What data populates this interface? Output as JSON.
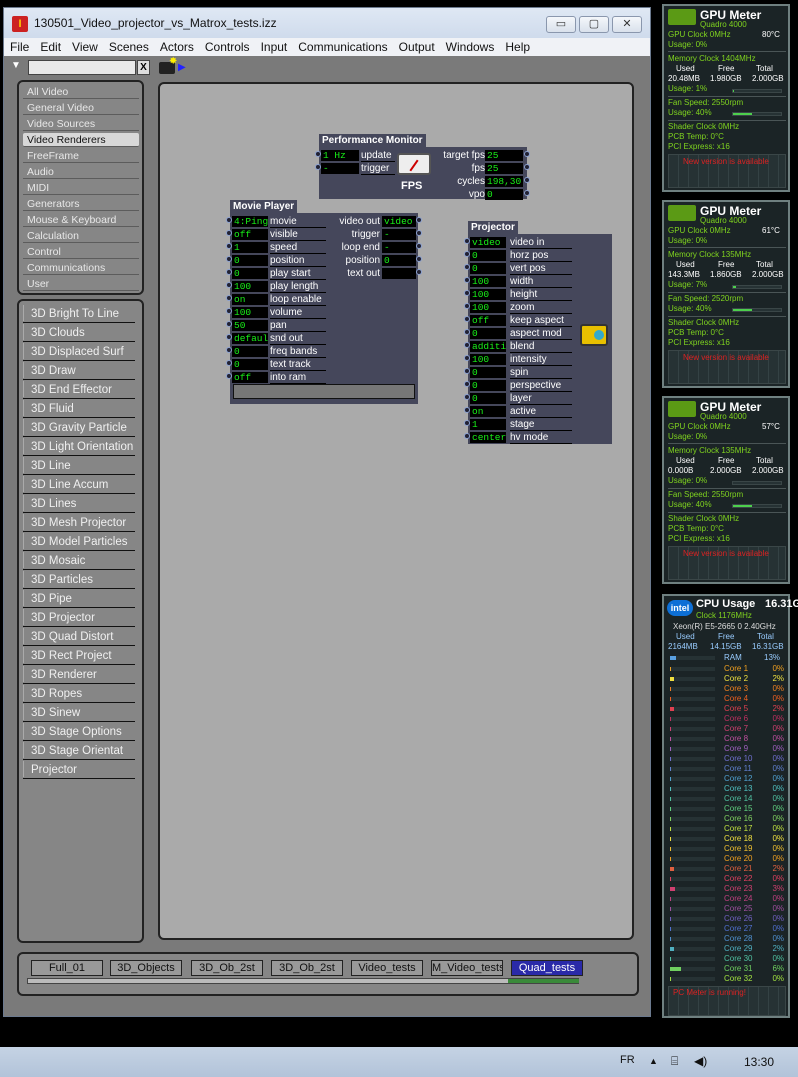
{
  "window": {
    "title": "130501_Video_projector_vs_Matrox_tests.izz",
    "minimize": "▭",
    "maximize": "▢",
    "close": "✕"
  },
  "menu": [
    "File",
    "Edit",
    "View",
    "Scenes",
    "Actors",
    "Controls",
    "Input",
    "Communications",
    "Output",
    "Windows",
    "Help"
  ],
  "toolbar": {
    "search_value": "",
    "clear": "X"
  },
  "categories": [
    "All Video",
    "General Video",
    "Video Sources",
    "Video Renderers",
    "FreeFrame",
    "Audio",
    "MIDI",
    "Generators",
    "Mouse & Keyboard",
    "Calculation",
    "Control",
    "Communications",
    "User"
  ],
  "selected_category": "Video Renderers",
  "actors_list": [
    "3D Bright To Line",
    "3D Clouds",
    "3D Displaced Surf",
    "3D Draw",
    "3D End Effector",
    "3D Fluid",
    "3D Gravity Particle",
    "3D Light Orientation",
    "3D Line",
    "3D Line Accum",
    "3D Lines",
    "3D Mesh Projector",
    "3D Model Particles",
    "3D Mosaic",
    "3D Particles",
    "3D Pipe",
    "3D Projector",
    "3D Quad Distort",
    "3D Rect Project",
    "3D Renderer",
    "3D Ropes",
    "3D Sinew",
    "3D Stage Options",
    "3D Stage Orientat",
    "Projector"
  ],
  "perf_monitor": {
    "title": "Performance Monitor",
    "inputs": [
      {
        "label": "update",
        "value": "1 Hz"
      },
      {
        "label": "trigger",
        "value": "-"
      }
    ],
    "outputs": [
      {
        "label": "target fps",
        "value": "25"
      },
      {
        "label": "fps",
        "value": "25"
      },
      {
        "label": "cycles",
        "value": "198,30"
      },
      {
        "label": "vpo",
        "value": "0"
      }
    ],
    "gauge_label": "FPS"
  },
  "movie_player": {
    "title": "Movie Player",
    "inputs": [
      {
        "label": "movie",
        "value": "4:Ping_"
      },
      {
        "label": "visible",
        "value": "off"
      },
      {
        "label": "speed",
        "value": "1"
      },
      {
        "label": "position",
        "value": "0"
      },
      {
        "label": "play start",
        "value": "0"
      },
      {
        "label": "play length",
        "value": "100"
      },
      {
        "label": "loop enable",
        "value": "on"
      },
      {
        "label": "volume",
        "value": "100"
      },
      {
        "label": "pan",
        "value": "50"
      },
      {
        "label": "snd out",
        "value": "default"
      },
      {
        "label": "freq bands",
        "value": "0"
      },
      {
        "label": "text track",
        "value": "0"
      },
      {
        "label": "into ram",
        "value": "off"
      }
    ],
    "outputs": [
      {
        "label": "video out",
        "value": "video"
      },
      {
        "label": "trigger",
        "value": "-"
      },
      {
        "label": "loop end",
        "value": "-"
      },
      {
        "label": "position",
        "value": "0"
      },
      {
        "label": "text out",
        "value": ""
      }
    ]
  },
  "projector": {
    "title": "Projector",
    "inputs": [
      {
        "label": "video in",
        "value": "video"
      },
      {
        "label": "horz pos",
        "value": "0"
      },
      {
        "label": "vert pos",
        "value": "0"
      },
      {
        "label": "width",
        "value": "100"
      },
      {
        "label": "height",
        "value": "100"
      },
      {
        "label": "zoom",
        "value": "100"
      },
      {
        "label": "keep aspect",
        "value": "off"
      },
      {
        "label": "aspect mod",
        "value": "0"
      },
      {
        "label": "blend",
        "value": "additive"
      },
      {
        "label": "intensity",
        "value": "100"
      },
      {
        "label": "spin",
        "value": "0"
      },
      {
        "label": "perspective",
        "value": "0"
      },
      {
        "label": "layer",
        "value": "0"
      },
      {
        "label": "active",
        "value": "on"
      },
      {
        "label": "stage",
        "value": "1"
      },
      {
        "label": "hv mode",
        "value": "centere"
      }
    ]
  },
  "scene_tabs": [
    "Full_01",
    "3D_Objects",
    "3D_Ob_2st",
    "3D_Ob_2st",
    "Video_tests",
    "M_Video_tests",
    "Quad_tests"
  ],
  "selected_scene": "Quad_tests",
  "gpu_meters": [
    {
      "title": "GPU Meter",
      "model": "Quadro 4000",
      "gpu_clock": "GPU Clock 0MHz",
      "temp": "80°C",
      "usage": "Usage: 0%",
      "mem_clock": "Memory Clock 1404MHz",
      "used_h": "Used",
      "free_h": "Free",
      "total_h": "Total",
      "used": "20.48MB",
      "free": "1.980GB",
      "total": "2.000GB",
      "mem_usage": "Usage: 1%",
      "fan": "Fan Speed: 2550rpm",
      "fan_usage": "Usage: 40%",
      "shader": "Shader Clock 0MHz",
      "pcb": "PCB Temp: 0°C",
      "pci": "PCI Express: x16",
      "new_version": "New version is available"
    },
    {
      "title": "GPU Meter",
      "model": "Quadro 4000",
      "gpu_clock": "GPU Clock 0MHz",
      "temp": "61°C",
      "usage": "Usage: 0%",
      "mem_clock": "Memory Clock 135MHz",
      "used_h": "Used",
      "free_h": "Free",
      "total_h": "Total",
      "used": "143.3MB",
      "free": "1.860GB",
      "total": "2.000GB",
      "mem_usage": "Usage: 7%",
      "fan": "Fan Speed: 2520rpm",
      "fan_usage": "Usage: 40%",
      "shader": "Shader Clock 0MHz",
      "pcb": "PCB Temp: 0°C",
      "pci": "PCI Express: x16",
      "new_version": "New version is available"
    },
    {
      "title": "GPU Meter",
      "model": "Quadro 4000",
      "gpu_clock": "GPU Clock 0MHz",
      "temp": "57°C",
      "usage": "Usage: 0%",
      "mem_clock": "Memory Clock 135MHz",
      "used_h": "Used",
      "free_h": "Free",
      "total_h": "Total",
      "used": "0.000B",
      "free": "2.000GB",
      "total": "2.000GB",
      "mem_usage": "Usage: 0%",
      "fan": "Fan Speed: 2550rpm",
      "fan_usage": "Usage: 40%",
      "shader": "Shader Clock 0MHz",
      "pcb": "PCB Temp: 0°C",
      "pci": "PCI Express: x16",
      "new_version": "New version is available"
    }
  ],
  "gpu_mem_usage_fraction": [
    0.01,
    0.07,
    0.0
  ],
  "gpu_fan_usage_fraction": [
    0.4,
    0.4,
    0.4
  ],
  "cpu": {
    "title": "CPU Usage",
    "total": "16.31GB",
    "clock": "Clock 1176MHz",
    "model": "Xeon(R) E5-2665 0 2.40GHz",
    "used_h": "Used",
    "free_h": "Free",
    "total_h": "Total",
    "used": "2164MB",
    "free": "14.15GB",
    "ram_label": "RAM",
    "ram_pct": "13%",
    "cores": [
      {
        "name": "Core 1",
        "pct": "0%"
      },
      {
        "name": "Core 2",
        "pct": "2%"
      },
      {
        "name": "Core 3",
        "pct": "0%"
      },
      {
        "name": "Core 4",
        "pct": "0%"
      },
      {
        "name": "Core 5",
        "pct": "2%"
      },
      {
        "name": "Core 6",
        "pct": "0%"
      },
      {
        "name": "Core 7",
        "pct": "0%"
      },
      {
        "name": "Core 8",
        "pct": "0%"
      },
      {
        "name": "Core 9",
        "pct": "0%"
      },
      {
        "name": "Core 10",
        "pct": "0%"
      },
      {
        "name": "Core 11",
        "pct": "0%"
      },
      {
        "name": "Core 12",
        "pct": "0%"
      },
      {
        "name": "Core 13",
        "pct": "0%"
      },
      {
        "name": "Core 14",
        "pct": "0%"
      },
      {
        "name": "Core 15",
        "pct": "0%"
      },
      {
        "name": "Core 16",
        "pct": "0%"
      },
      {
        "name": "Core 17",
        "pct": "0%"
      },
      {
        "name": "Core 18",
        "pct": "0%"
      },
      {
        "name": "Core 19",
        "pct": "0%"
      },
      {
        "name": "Core 20",
        "pct": "0%"
      },
      {
        "name": "Core 21",
        "pct": "2%"
      },
      {
        "name": "Core 22",
        "pct": "0%"
      },
      {
        "name": "Core 23",
        "pct": "3%"
      },
      {
        "name": "Core 24",
        "pct": "0%"
      },
      {
        "name": "Core 25",
        "pct": "0%"
      },
      {
        "name": "Core 26",
        "pct": "0%"
      },
      {
        "name": "Core 27",
        "pct": "0%"
      },
      {
        "name": "Core 28",
        "pct": "0%"
      },
      {
        "name": "Core 29",
        "pct": "2%"
      },
      {
        "name": "Core 30",
        "pct": "0%"
      },
      {
        "name": "Core 31",
        "pct": "6%"
      },
      {
        "name": "Core 32",
        "pct": "0%"
      }
    ],
    "core_colors": [
      "#f0a020",
      "#f0e040",
      "#f08020",
      "#f06020",
      "#e04050",
      "#c03060",
      "#d04070",
      "#c050a0",
      "#a060c0",
      "#7070d0",
      "#6080d0",
      "#50a0d0",
      "#50c0c0",
      "#50c0a0",
      "#60d080",
      "#80d060",
      "#c0e040",
      "#f0e040",
      "#f0c030",
      "#f0a020",
      "#e06040",
      "#e04060",
      "#d04070",
      "#c04080",
      "#a050a0",
      "#7060c0",
      "#5070d0",
      "#5090d0",
      "#50b0c0",
      "#50c0a0",
      "#70d060",
      "#a0e040"
    ],
    "footer": "PC Meter is running!"
  },
  "taskbar": {
    "lang": "FR",
    "clock": "13:30"
  }
}
